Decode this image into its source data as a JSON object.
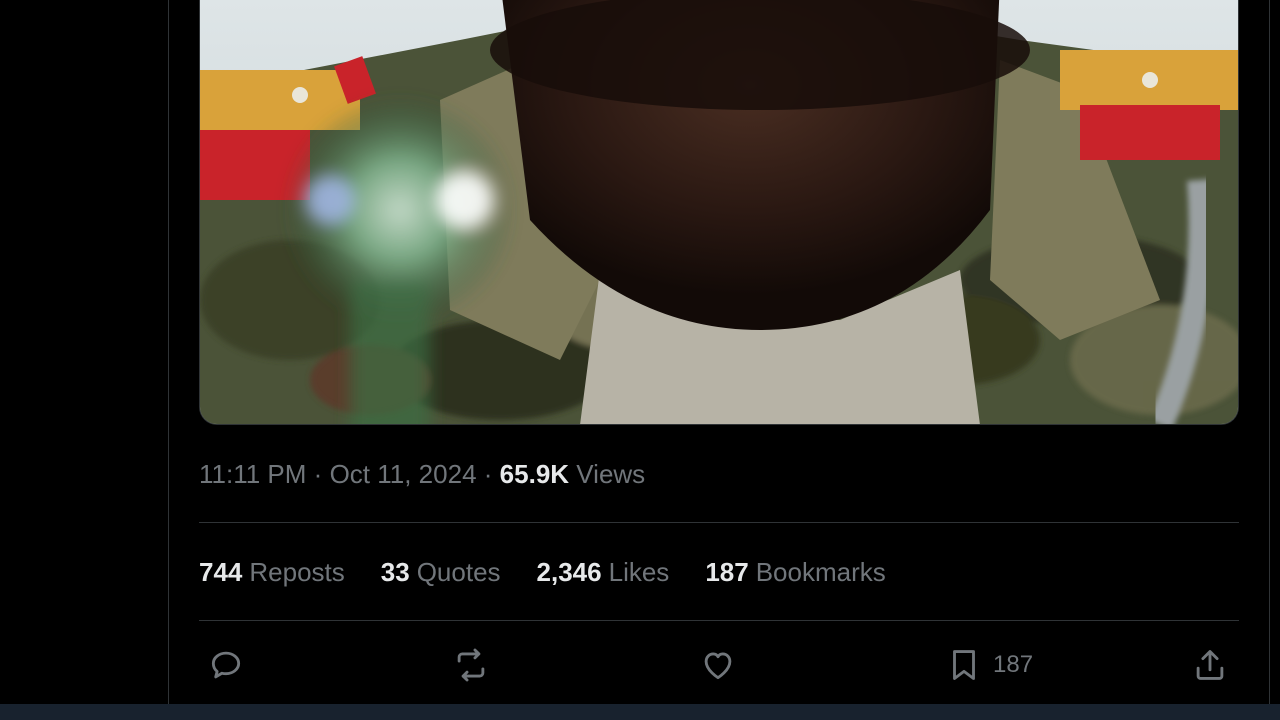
{
  "tweet": {
    "time": "11:11 PM",
    "date": "Oct 11, 2024",
    "separator": "·",
    "views_count": "65.9K",
    "views_label": "Views"
  },
  "stats": {
    "reposts": {
      "count": "744",
      "label": "Reposts"
    },
    "quotes": {
      "count": "33",
      "label": "Quotes"
    },
    "likes": {
      "count": "2,346",
      "label": "Likes"
    },
    "bookmarks": {
      "count": "187",
      "label": "Bookmarks"
    }
  },
  "actions": {
    "reply_icon": "reply-icon",
    "repost_icon": "repost-icon",
    "like_icon": "heart-icon",
    "bookmark_icon": "bookmark-icon",
    "bookmark_count": "187",
    "share_icon": "share-icon"
  },
  "colors": {
    "background": "#000000",
    "text_primary": "#e7e9ea",
    "text_secondary": "#71767b",
    "divider": "#2f3336"
  }
}
